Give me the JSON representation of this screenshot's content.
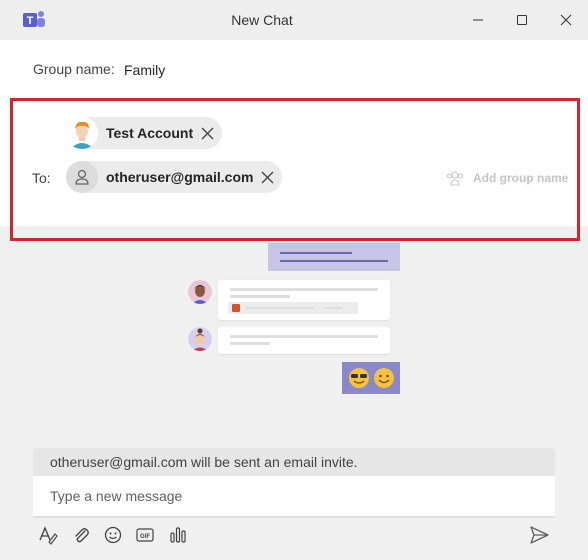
{
  "window": {
    "title": "New Chat",
    "app_icon": "teams-logo-icon",
    "controls": [
      "minimize-icon",
      "maximize-icon",
      "close-icon"
    ]
  },
  "group": {
    "label": "Group name:",
    "value": "Family"
  },
  "recipients": {
    "to_label": "To:",
    "chips": [
      {
        "name": "Test Account",
        "avatar": "user-avatar-photo",
        "remove_icon": "close-icon"
      },
      {
        "name": "otheruser@gmail.com",
        "avatar": "person-icon",
        "remove_icon": "close-icon"
      }
    ],
    "add_group_name": "Add group name"
  },
  "invite_notice": "otheruser@gmail.com will be sent an email invite.",
  "composer": {
    "placeholder": "Type a new message"
  },
  "toolbar": {
    "icons": [
      "format-icon",
      "attach-icon",
      "emoji-icon",
      "gif-icon",
      "poll-icon"
    ],
    "send_icon": "send-icon"
  },
  "colors": {
    "highlight_border": "#d1262c",
    "teams_purple": "#5b5fc7",
    "chip_bg": "#ebebeb"
  }
}
